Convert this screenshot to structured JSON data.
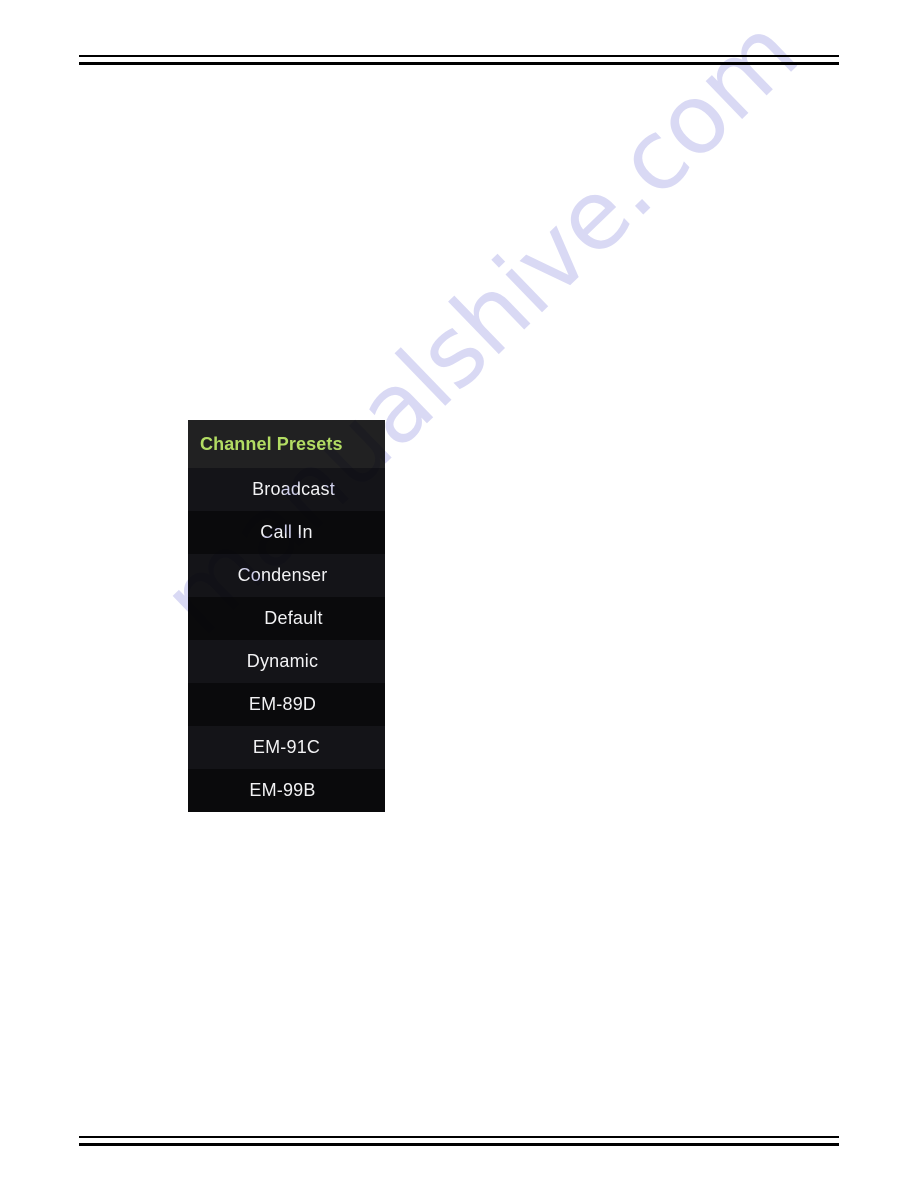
{
  "document": {
    "background_color": "#ffffff",
    "rules": {
      "top": [
        "thin",
        "thick"
      ],
      "bottom": [
        "thin",
        "thick"
      ],
      "color": "#000000"
    }
  },
  "watermark": {
    "text": "manualshive.com",
    "color": "#d9d9f4",
    "rotation_degrees": -44
  },
  "preset_panel": {
    "header": {
      "title": "Channel Presets",
      "text_color": "#b2dc63",
      "background_color": "#212122"
    },
    "background_color": "#0b0b0d",
    "item_text_color": "#f2f2f4",
    "stripe_colors": [
      "#141418",
      "#0a0a0c"
    ],
    "items": [
      {
        "label": "Broadcast"
      },
      {
        "label": "Call In"
      },
      {
        "label": "Condenser"
      },
      {
        "label": "Default"
      },
      {
        "label": "Dynamic"
      },
      {
        "label": "EM-89D"
      },
      {
        "label": "EM-91C"
      },
      {
        "label": "EM-99B"
      }
    ]
  }
}
